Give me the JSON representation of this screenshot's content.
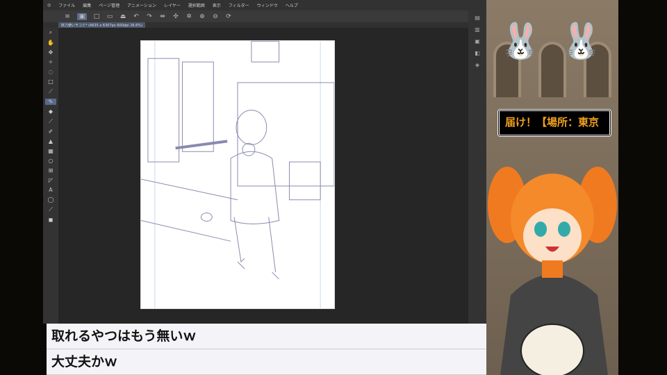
{
  "app": {
    "menu": [
      "ファイル",
      "編集",
      "ページ管理",
      "アニメーション",
      "レイヤー",
      "選択範囲",
      "表示",
      "フィルター",
      "ウィンドウ",
      "ヘルプ"
    ],
    "tab_title": "妖刀使いモコミ* (4635 x 6307px 600dpi 26.6%)"
  },
  "chat": {
    "messages": [
      "取れるやつはもう無いｗ",
      "大丈夫かｗ"
    ]
  },
  "overlay": {
    "banner_text": "届け！【場所：東京"
  },
  "colors": {
    "accent": "#5a6a8a",
    "banner_text": "#f0a020",
    "bunny": "#e88ee8"
  }
}
